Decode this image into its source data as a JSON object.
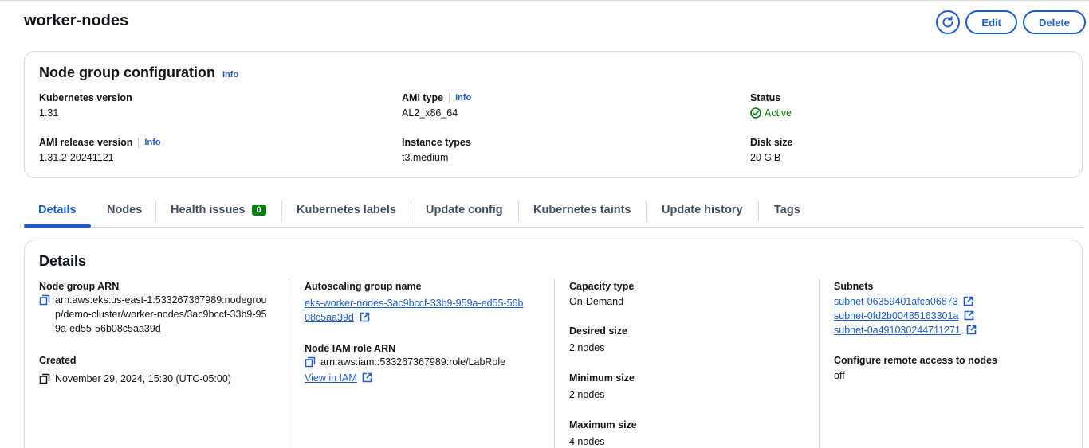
{
  "header": {
    "title": "worker-nodes",
    "edit_label": "Edit",
    "delete_label": "Delete"
  },
  "config": {
    "title": "Node group configuration",
    "info": "Info",
    "kubernetes_version": {
      "label": "Kubernetes version",
      "value": "1.31"
    },
    "ami_type": {
      "label": "AMI type",
      "info": "Info",
      "value": "AL2_x86_64"
    },
    "status": {
      "label": "Status",
      "value": "Active"
    },
    "ami_release": {
      "label": "AMI release version",
      "info": "Info",
      "value": "1.31.2-20241121"
    },
    "instance_types": {
      "label": "Instance types",
      "value": "t3.medium"
    },
    "disk_size": {
      "label": "Disk size",
      "value": "20 GiB"
    }
  },
  "tabs": [
    {
      "label": "Details",
      "active": true
    },
    {
      "label": "Nodes"
    },
    {
      "label": "Health issues",
      "badge": "0"
    },
    {
      "label": "Kubernetes labels"
    },
    {
      "label": "Update config"
    },
    {
      "label": "Kubernetes taints"
    },
    {
      "label": "Update history"
    },
    {
      "label": "Tags"
    }
  ],
  "details": {
    "title": "Details",
    "node_group_arn": {
      "label": "Node group ARN",
      "value": "arn:aws:eks:us-east-1:533267367989:nodegroup/demo-cluster/worker-nodes/3ac9bccf-33b9-959a-ed55-56b08c5aa39d"
    },
    "created": {
      "label": "Created",
      "value": "November 29, 2024, 15:30 (UTC-05:00)"
    },
    "asg_name": {
      "label": "Autoscaling group name",
      "value": "eks-worker-nodes-3ac9bccf-33b9-959a-ed55-56b08c5aa39d"
    },
    "node_iam_role": {
      "label": "Node IAM role ARN",
      "value": "arn:aws:iam::533267367989:role/LabRole",
      "link": "View in IAM"
    },
    "capacity_type": {
      "label": "Capacity type",
      "value": "On-Demand"
    },
    "desired_size": {
      "label": "Desired size",
      "value": "2 nodes"
    },
    "minimum_size": {
      "label": "Minimum size",
      "value": "2 nodes"
    },
    "maximum_size": {
      "label": "Maximum size",
      "value": "4 nodes"
    },
    "subnets": {
      "label": "Subnets",
      "items": [
        "subnet-06359401afca06873",
        "subnet-0fd2b00485163301a",
        "subnet-0a491030244711271"
      ]
    },
    "remote_access": {
      "label": "Configure remote access to nodes",
      "value": "off"
    }
  },
  "colors": {
    "accent": "#1d5bd0",
    "success": "#037f0c",
    "text": "#0f141a",
    "border": "#d5dbdb"
  }
}
